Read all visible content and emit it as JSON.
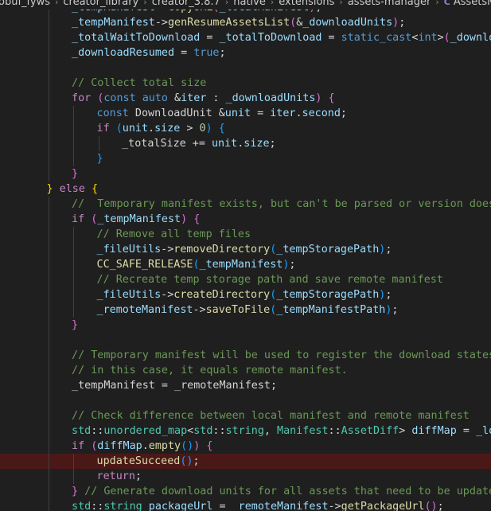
{
  "breadcrumb": {
    "items": [
      "obuf_fyws",
      "creator_library",
      "creator_3.8.7",
      "native",
      "extensions",
      "assets-manager"
    ],
    "file_icon": "C",
    "file": "AssetsManagerEx.c"
  },
  "colors": {
    "background": "#1f1f1f",
    "error_line": "#4b1818",
    "comment": "#6a9955",
    "keyword": "#569cd6",
    "control": "#c586c0",
    "variable": "#9cdcfe",
    "function": "#dcdcaa",
    "type": "#4ec9b0"
  },
  "code_lines": [
    {
      "indent": 8,
      "tokens": [
        [
          "_tempManifest",
          "var"
        ],
        [
          "->",
          "op"
        ],
        [
          "copyURL",
          "fn"
        ],
        [
          "(",
          "br2"
        ],
        [
          "_localManifest",
          "var"
        ],
        [
          ")",
          "br2"
        ],
        [
          ";",
          "op"
        ]
      ]
    },
    {
      "indent": 8,
      "tokens": [
        [
          "_tempManifest",
          "var"
        ],
        [
          "->",
          "op"
        ],
        [
          "genResumeAssetsList",
          "fn"
        ],
        [
          "(",
          "br2"
        ],
        [
          "&",
          "op"
        ],
        [
          "_downloadUnits",
          "var"
        ],
        [
          ")",
          "br2"
        ],
        [
          ";",
          "op"
        ]
      ]
    },
    {
      "indent": 8,
      "tokens": [
        [
          "_totalWaitToDownload",
          "var"
        ],
        [
          " = ",
          "op"
        ],
        [
          "_totalToDownload",
          "var"
        ],
        [
          " = ",
          "op"
        ],
        [
          "static_cast",
          "kw"
        ],
        [
          "<",
          "op"
        ],
        [
          "int",
          "kw"
        ],
        [
          ">",
          "op"
        ],
        [
          "(",
          "br2"
        ],
        [
          "_downloadU",
          "var"
        ]
      ]
    },
    {
      "indent": 8,
      "tokens": [
        [
          "_downloadResumed",
          "var"
        ],
        [
          " = ",
          "op"
        ],
        [
          "true",
          "kw"
        ],
        [
          ";",
          "op"
        ]
      ]
    },
    {
      "indent": 0,
      "tokens": []
    },
    {
      "indent": 8,
      "tokens": [
        [
          "// Collect total size",
          "cmt"
        ]
      ]
    },
    {
      "indent": 8,
      "tokens": [
        [
          "for",
          "ctl"
        ],
        [
          " ",
          "op"
        ],
        [
          "(",
          "br2"
        ],
        [
          "const",
          "kw"
        ],
        [
          " ",
          "op"
        ],
        [
          "auto",
          "kw"
        ],
        [
          " &",
          "op"
        ],
        [
          "iter",
          "var"
        ],
        [
          " : ",
          "op"
        ],
        [
          "_downloadUnits",
          "var"
        ],
        [
          ")",
          "br2"
        ],
        [
          " ",
          "op"
        ],
        [
          "{",
          "br2"
        ]
      ]
    },
    {
      "indent": 12,
      "tokens": [
        [
          "const",
          "kw"
        ],
        [
          " ",
          "op"
        ],
        [
          "DownloadUnit",
          "op"
        ],
        [
          " &",
          "op"
        ],
        [
          "unit",
          "var"
        ],
        [
          " = ",
          "op"
        ],
        [
          "iter",
          "var"
        ],
        [
          ".",
          "op"
        ],
        [
          "second",
          "var"
        ],
        [
          ";",
          "op"
        ]
      ]
    },
    {
      "indent": 12,
      "tokens": [
        [
          "if",
          "ctl"
        ],
        [
          " ",
          "op"
        ],
        [
          "(",
          "br3"
        ],
        [
          "unit",
          "var"
        ],
        [
          ".",
          "op"
        ],
        [
          "size",
          "var"
        ],
        [
          " > ",
          "op"
        ],
        [
          "0",
          "num"
        ],
        [
          ")",
          "br3"
        ],
        [
          " ",
          "op"
        ],
        [
          "{",
          "br3"
        ]
      ]
    },
    {
      "indent": 16,
      "tokens": [
        [
          "_totalSize",
          "op"
        ],
        [
          " += ",
          "op"
        ],
        [
          "unit",
          "var"
        ],
        [
          ".",
          "op"
        ],
        [
          "size",
          "var"
        ],
        [
          ";",
          "op"
        ]
      ]
    },
    {
      "indent": 12,
      "tokens": [
        [
          "}",
          "br3"
        ]
      ]
    },
    {
      "indent": 8,
      "tokens": [
        [
          "}",
          "br2"
        ]
      ]
    },
    {
      "indent": 4,
      "tokens": [
        [
          "}",
          "br1"
        ],
        [
          " ",
          "op"
        ],
        [
          "else",
          "ctl"
        ],
        [
          " ",
          "op"
        ],
        [
          "{",
          "br1"
        ]
      ]
    },
    {
      "indent": 8,
      "tokens": [
        [
          "//  Temporary manifest exists, but can't be parsed or version doesn't",
          "cmt"
        ]
      ]
    },
    {
      "indent": 8,
      "tokens": [
        [
          "if",
          "ctl"
        ],
        [
          " ",
          "op"
        ],
        [
          "(",
          "br2"
        ],
        [
          "_tempManifest",
          "var"
        ],
        [
          ")",
          "br2"
        ],
        [
          " ",
          "op"
        ],
        [
          "{",
          "br2"
        ]
      ]
    },
    {
      "indent": 12,
      "tokens": [
        [
          "// Remove all temp files",
          "cmt"
        ]
      ]
    },
    {
      "indent": 12,
      "tokens": [
        [
          "_fileUtils",
          "var"
        ],
        [
          "->",
          "op"
        ],
        [
          "removeDirectory",
          "fn"
        ],
        [
          "(",
          "br3"
        ],
        [
          "_tempStoragePath",
          "var"
        ],
        [
          ")",
          "br3"
        ],
        [
          ";",
          "op"
        ]
      ]
    },
    {
      "indent": 12,
      "tokens": [
        [
          "CC_SAFE_RELEASE",
          "mac"
        ],
        [
          "(",
          "br3"
        ],
        [
          "_tempManifest",
          "var"
        ],
        [
          ")",
          "br3"
        ],
        [
          ";",
          "op"
        ]
      ]
    },
    {
      "indent": 12,
      "tokens": [
        [
          "// Recreate temp storage path and save remote manifest",
          "cmt"
        ]
      ]
    },
    {
      "indent": 12,
      "tokens": [
        [
          "_fileUtils",
          "var"
        ],
        [
          "->",
          "op"
        ],
        [
          "createDirectory",
          "fn"
        ],
        [
          "(",
          "br3"
        ],
        [
          "_tempStoragePath",
          "var"
        ],
        [
          ")",
          "br3"
        ],
        [
          ";",
          "op"
        ]
      ]
    },
    {
      "indent": 12,
      "tokens": [
        [
          "_remoteManifest",
          "var"
        ],
        [
          "->",
          "op"
        ],
        [
          "saveToFile",
          "fn"
        ],
        [
          "(",
          "br3"
        ],
        [
          "_tempManifestPath",
          "var"
        ],
        [
          ")",
          "br3"
        ],
        [
          ";",
          "op"
        ]
      ]
    },
    {
      "indent": 8,
      "tokens": [
        [
          "}",
          "br2"
        ]
      ]
    },
    {
      "indent": 0,
      "tokens": []
    },
    {
      "indent": 8,
      "tokens": [
        [
          "// Temporary manifest will be used to register the download states of",
          "cmt"
        ]
      ]
    },
    {
      "indent": 8,
      "tokens": [
        [
          "// in this case, it equals remote manifest.",
          "cmt"
        ]
      ]
    },
    {
      "indent": 8,
      "tokens": [
        [
          "_tempManifest",
          "op"
        ],
        [
          " = ",
          "op"
        ],
        [
          "_remoteManifest",
          "op"
        ],
        [
          ";",
          "op"
        ]
      ]
    },
    {
      "indent": 0,
      "tokens": []
    },
    {
      "indent": 8,
      "tokens": [
        [
          "// Check difference between local manifest and remote manifest",
          "cmt"
        ]
      ]
    },
    {
      "indent": 8,
      "tokens": [
        [
          "std",
          "type"
        ],
        [
          "::",
          "op"
        ],
        [
          "unordered_map",
          "type"
        ],
        [
          "<",
          "op"
        ],
        [
          "std",
          "type"
        ],
        [
          "::",
          "op"
        ],
        [
          "string",
          "type"
        ],
        [
          ", ",
          "op"
        ],
        [
          "Manifest",
          "type"
        ],
        [
          "::",
          "op"
        ],
        [
          "AssetDiff",
          "type"
        ],
        [
          "> ",
          "op"
        ],
        [
          "diffMap",
          "var"
        ],
        [
          " = ",
          "op"
        ],
        [
          "_local",
          "var"
        ]
      ]
    },
    {
      "indent": 8,
      "tokens": [
        [
          "if",
          "ctl"
        ],
        [
          " ",
          "op"
        ],
        [
          "(",
          "br2"
        ],
        [
          "diffMap",
          "var"
        ],
        [
          ".",
          "op"
        ],
        [
          "empty",
          "fn"
        ],
        [
          "()",
          "br3"
        ],
        [
          ")",
          "br2"
        ],
        [
          " ",
          "op"
        ],
        [
          "{",
          "br2"
        ]
      ]
    },
    {
      "indent": 12,
      "highlight": true,
      "tokens": [
        [
          "updateSucceed",
          "fn"
        ],
        [
          "()",
          "br3"
        ],
        [
          ";",
          "op"
        ]
      ]
    },
    {
      "indent": 12,
      "tokens": [
        [
          "return",
          "ctl"
        ],
        [
          ";",
          "op"
        ]
      ]
    },
    {
      "indent": 8,
      "tokens": [
        [
          "}",
          "br2"
        ],
        [
          " ",
          "op"
        ],
        [
          "// Generate download units for all assets that need to be updated o",
          "cmt"
        ]
      ]
    },
    {
      "indent": 8,
      "tokens": [
        [
          "std",
          "type"
        ],
        [
          "::",
          "op"
        ],
        [
          "string",
          "type"
        ],
        [
          " ",
          "op"
        ],
        [
          "packageUrl",
          "var"
        ],
        [
          " = ",
          "op"
        ],
        [
          "_remoteManifest",
          "var"
        ],
        [
          "->",
          "op"
        ],
        [
          "getPackageUrl",
          "fn"
        ],
        [
          "()",
          "br2"
        ],
        [
          ";",
          "op"
        ]
      ]
    }
  ]
}
